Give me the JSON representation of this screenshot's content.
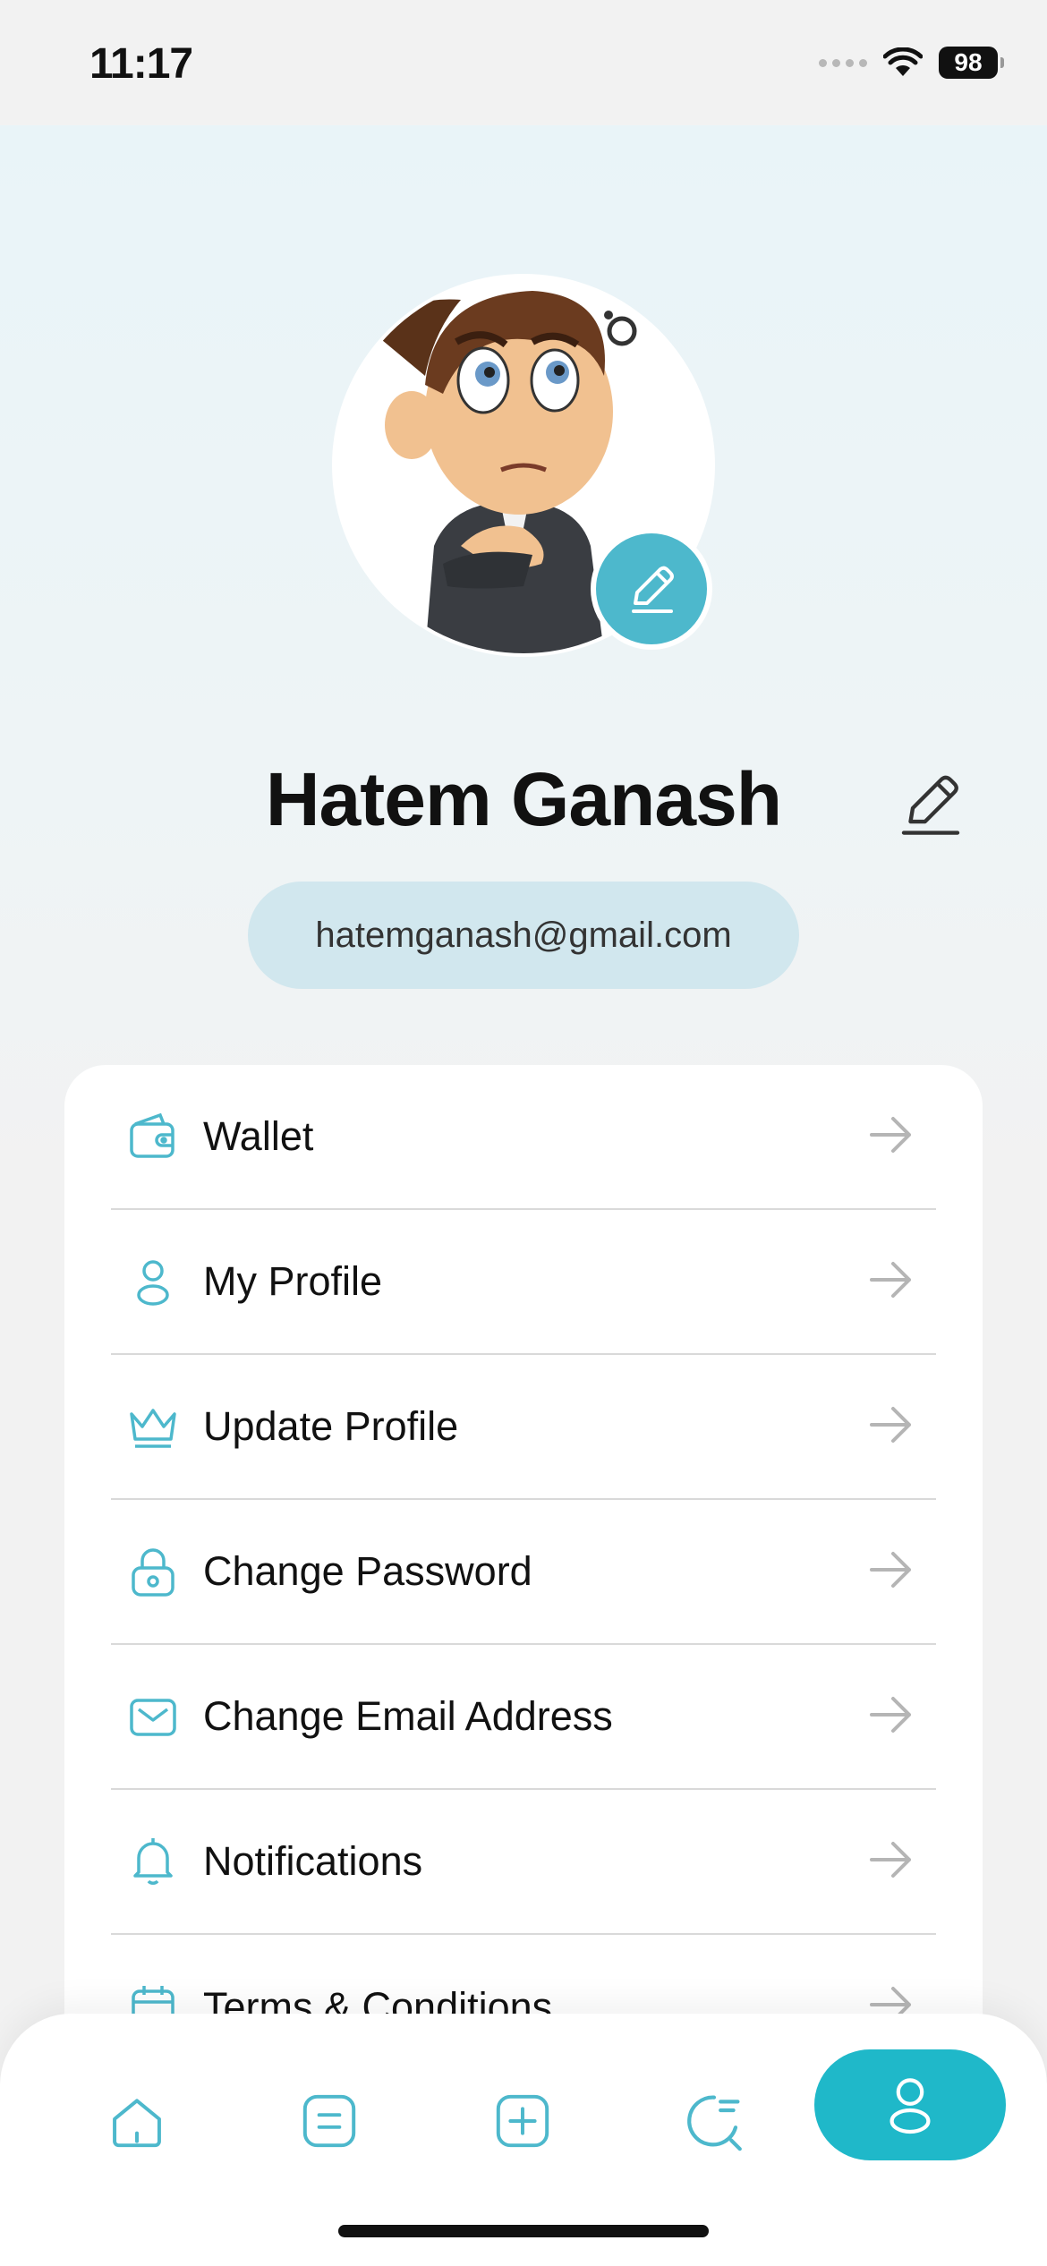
{
  "status": {
    "time": "11:17",
    "battery": "98"
  },
  "profile": {
    "name": "Hatem Ganash",
    "email": "hatemganash@gmail.com"
  },
  "menu": {
    "items": [
      {
        "label": "Wallet",
        "icon": "wallet-icon"
      },
      {
        "label": "My Profile",
        "icon": "user-icon"
      },
      {
        "label": "Update Profile",
        "icon": "crown-icon"
      },
      {
        "label": "Change Password",
        "icon": "lock-icon"
      },
      {
        "label": "Change Email Address",
        "icon": "mail-icon"
      },
      {
        "label": "Notifications",
        "icon": "bell-icon"
      },
      {
        "label": "Terms & Conditions",
        "icon": "calendar-icon"
      }
    ]
  },
  "tabbar": {
    "tabs": [
      {
        "icon": "home-icon"
      },
      {
        "icon": "list-icon"
      },
      {
        "icon": "add-icon"
      },
      {
        "icon": "search-icon"
      },
      {
        "icon": "profile-icon",
        "active": true
      }
    ]
  },
  "colors": {
    "accent": "#1fb8c9",
    "icon": "#4db8cc"
  }
}
